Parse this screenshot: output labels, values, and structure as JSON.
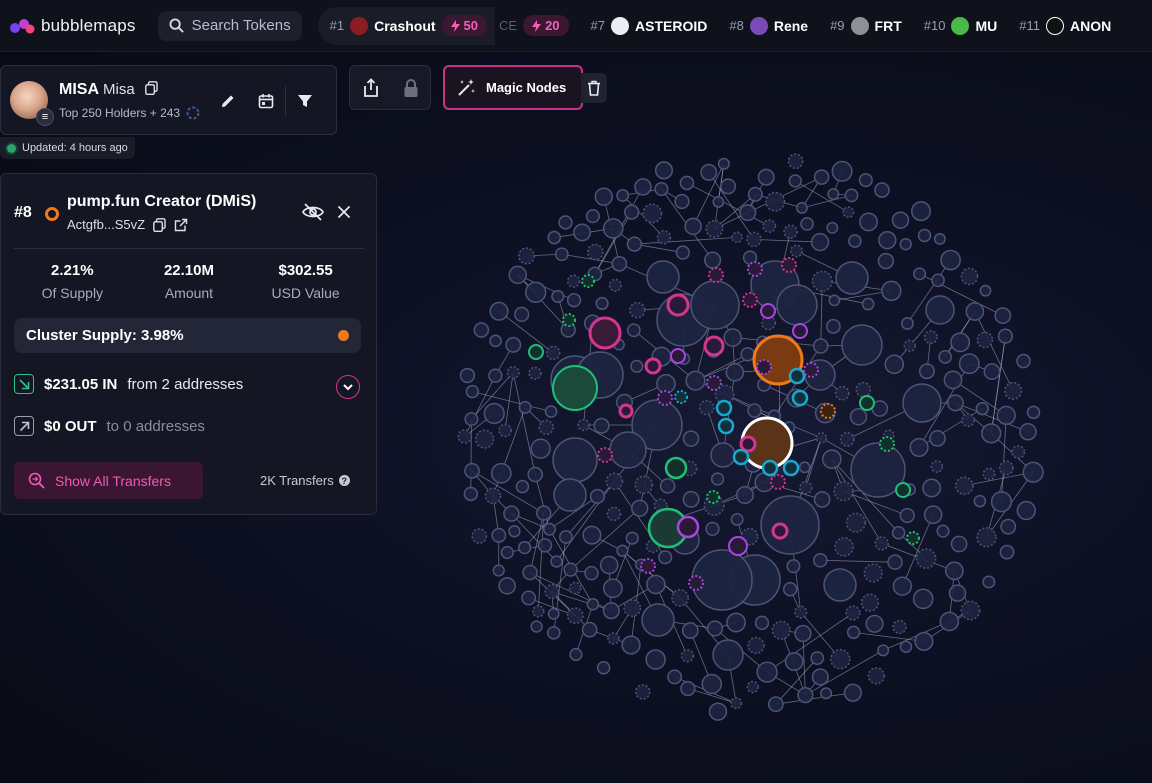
{
  "app": {
    "name": "bubblemaps"
  },
  "search": {
    "placeholder": "Search Tokens"
  },
  "ticker": {
    "first": {
      "rank": "#1",
      "name": "Crashout",
      "boost": "50",
      "icon_color": "#8b1c22"
    },
    "partial": {
      "name_fragment": "CE",
      "boost": "20"
    },
    "items": [
      {
        "rank": "#7",
        "name": "ASTEROID",
        "icon_color": "#e9eef5"
      },
      {
        "rank": "#8",
        "name": "Rene",
        "icon_color": "#7a4bb8"
      },
      {
        "rank": "#9",
        "name": "FRT",
        "icon_color": "#8f8f97"
      },
      {
        "rank": "#10",
        "name": "MU",
        "icon_color": "#4bb84a"
      },
      {
        "rank": "#11",
        "name": "ANON",
        "icon_color": "#111111"
      }
    ]
  },
  "token": {
    "symbol": "MISA",
    "name": "Misa",
    "holders": "Top 250 Holders + 243",
    "updated": "Updated: 4 hours ago"
  },
  "toolbar": {
    "magic_label": "Magic Nodes"
  },
  "wallet": {
    "rank": "#8",
    "title": "pump.fun Creator (DMiS)",
    "address": "Actgfb...S5vZ",
    "stats": [
      {
        "value": "2.21%",
        "label": "Of Supply"
      },
      {
        "value": "22.10M",
        "label": "Amount"
      },
      {
        "value": "$302.55",
        "label": "USD Value"
      }
    ],
    "cluster_supply": "Cluster Supply: 3.98%",
    "in_amount": "$231.05 IN",
    "in_desc": "from 2 addresses",
    "out_amount": "$0 OUT",
    "out_desc": "to 0 addresses",
    "show_transfers": "Show All Transfers",
    "transfers_count": "2K Transfers"
  },
  "colors": {
    "accent_pink": "#d6358f",
    "accent_orange": "#f07a1a",
    "node_fill": "#1e2440",
    "node_stroke": "#4b5578",
    "node_green": "#1fbf7a",
    "node_purple": "#a646e0",
    "node_cyan": "#1aa7d0"
  }
}
